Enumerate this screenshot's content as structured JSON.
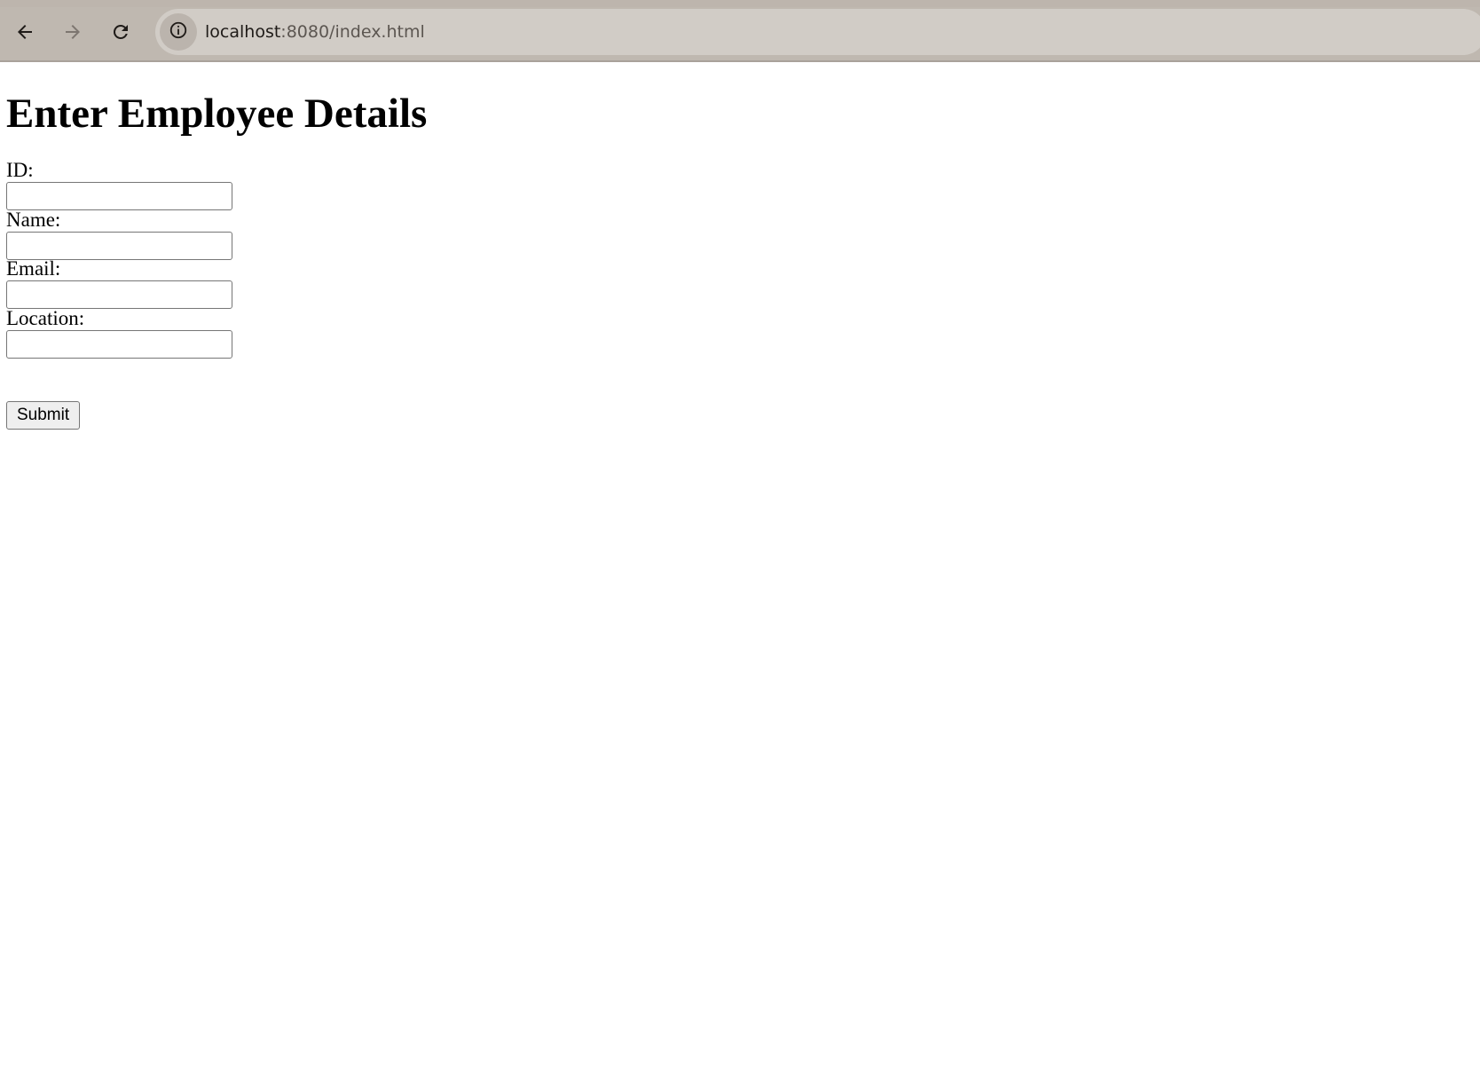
{
  "browser": {
    "url_host": "localhost",
    "url_rest": ":8080/index.html",
    "back_icon": "arrow-left-icon",
    "forward_icon": "arrow-right-icon",
    "reload_icon": "reload-icon",
    "site_info_icon": "info-icon"
  },
  "page": {
    "title": "Enter Employee Details",
    "fields": [
      {
        "label": "ID:",
        "value": ""
      },
      {
        "label": "Name:",
        "value": ""
      },
      {
        "label": "Email:",
        "value": ""
      },
      {
        "label": "Location:",
        "value": ""
      }
    ],
    "submit_label": "Submit"
  },
  "colors": {
    "chrome_background": "#bfb8b0",
    "omnibox_background": "#d1ccc6",
    "page_background": "#ffffff",
    "button_background": "#efefef"
  }
}
